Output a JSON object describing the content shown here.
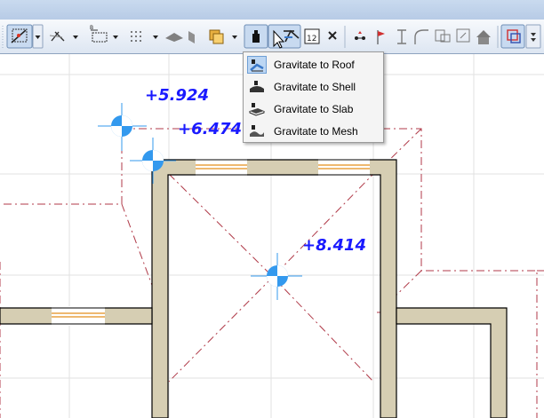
{
  "toolbar": {
    "tools": [
      {
        "name": "magic-wand-icon"
      },
      {
        "name": "trace-icon"
      },
      {
        "name": "dimension-icon"
      },
      {
        "name": "grid-snap-icon"
      },
      {
        "name": "fill-tool-icon"
      },
      {
        "name": "layer-combo-icon"
      },
      {
        "name": "gravity-icon"
      },
      {
        "name": "gravity-roof-icon"
      },
      {
        "name": "coordinates-icon"
      },
      {
        "name": "cross-cursor-icon"
      },
      {
        "name": "snap-point-icon"
      },
      {
        "name": "snap-flag-icon"
      },
      {
        "name": "elevation-icon"
      },
      {
        "name": "curve-icon"
      },
      {
        "name": "trace-reference-icon"
      },
      {
        "name": "house-icon"
      },
      {
        "name": "suspend-groups-icon"
      }
    ]
  },
  "gravity_menu": {
    "items": [
      {
        "label": "Gravitate to Roof",
        "icon": "roof-gravity-icon",
        "active": true
      },
      {
        "label": "Gravitate to Shell",
        "icon": "shell-gravity-icon",
        "active": false
      },
      {
        "label": "Gravitate to Slab",
        "icon": "slab-gravity-icon",
        "active": false
      },
      {
        "label": "Gravitate to Mesh",
        "icon": "mesh-gravity-icon",
        "active": false
      }
    ]
  },
  "drawing": {
    "elevations": [
      {
        "label": "+5.924"
      },
      {
        "label": "+6.474"
      },
      {
        "label": "+8.414"
      }
    ],
    "colors": {
      "wall": "#d6ceb3",
      "roof_line": "#b03a48",
      "marker": "#3399ee",
      "elevation_text": "#1a1aff"
    }
  }
}
